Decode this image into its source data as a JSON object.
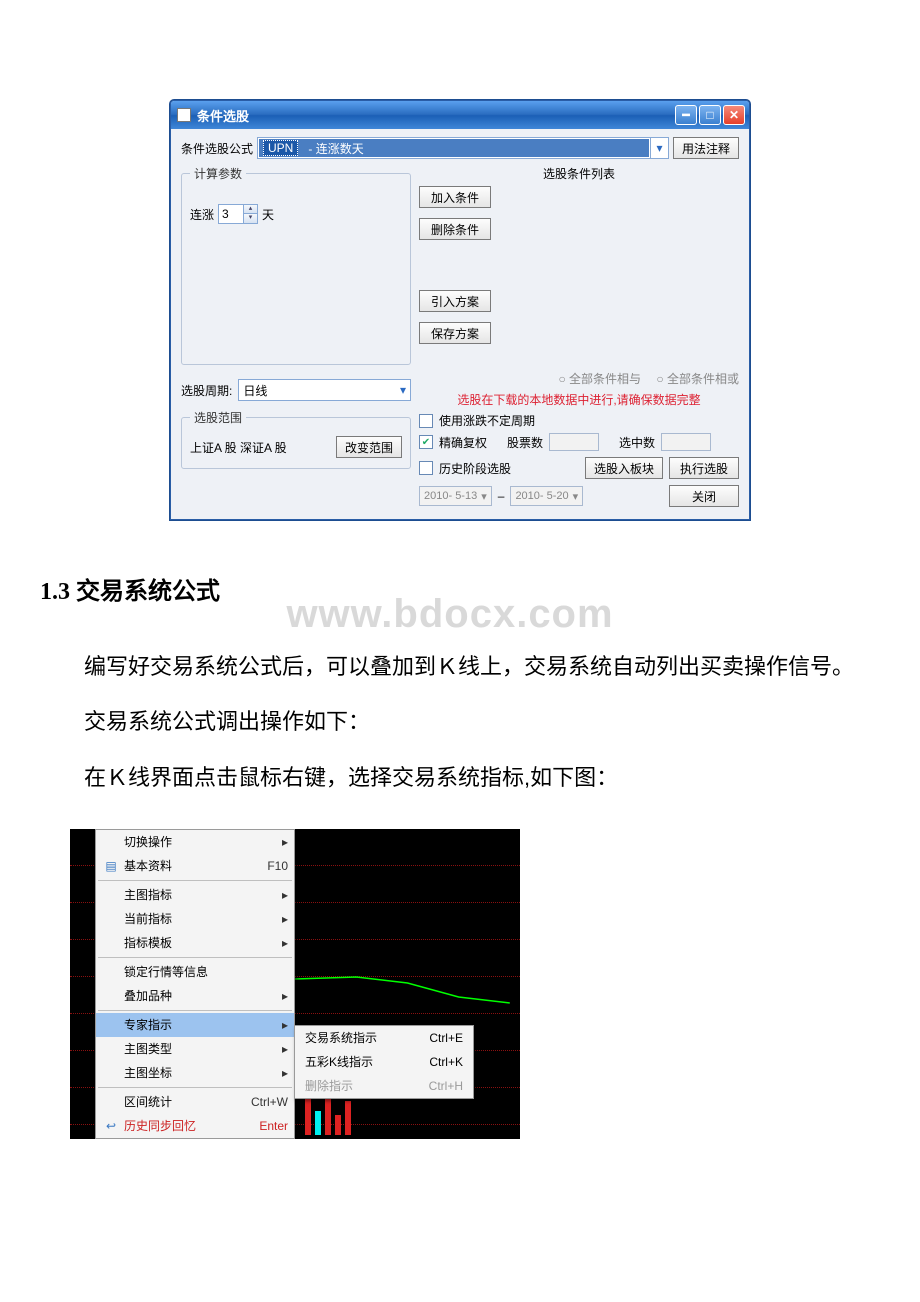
{
  "dialog": {
    "title": "条件选股",
    "formula_label": "条件选股公式",
    "formula_code": "UPN",
    "formula_name": "- 连涨数天",
    "usage_btn": "用法注释",
    "calc_group": "计算参数",
    "param_prefix": "连涨",
    "param_value": "3",
    "param_suffix": "天",
    "period_label": "选股周期:",
    "period_value": "日线",
    "range_group": "选股范围",
    "range_text": "上证A 股 深证A 股",
    "change_range_btn": "改变范围",
    "cond_list_title": "选股条件列表",
    "btn_add": "加入条件",
    "btn_del": "删除条件",
    "btn_import": "引入方案",
    "btn_save": "保存方案",
    "radio_and": "全部条件相与",
    "radio_or": "全部条件相或",
    "warning": "选股在下载的本地数据中进行,请确保数据完整",
    "chk_cycle": "使用涨跌不定周期",
    "chk_fuquan": "精确复权",
    "stock_count_lbl": "股票数",
    "selected_lbl": "选中数",
    "chk_history": "历史阶段选股",
    "date_from": "2010- 5-13",
    "date_to": "2010- 5-20",
    "btn_to_block": "选股入板块",
    "btn_exec": "执行选股",
    "btn_close": "关闭"
  },
  "doc": {
    "heading_prefix": "1.3",
    "heading": "交易系统公式",
    "watermark": "www.bdocx.com",
    "p1": "编写好交易系统公式后，可以叠加到Ｋ线上，交易系统自动列出买卖操作信号。",
    "p2": "交易系统公式调出操作如下：",
    "p3": "在Ｋ线界面点击鼠标右键，选择交易系统指标,如下图："
  },
  "menu": {
    "items": [
      {
        "label": "切换操作",
        "shortcut": "",
        "arrow": true,
        "icon": ""
      },
      {
        "label": "基本资料",
        "shortcut": "F10",
        "arrow": false,
        "icon": "list"
      },
      {
        "sep": true
      },
      {
        "label": "主图指标",
        "shortcut": "",
        "arrow": true
      },
      {
        "label": "当前指标",
        "shortcut": "",
        "arrow": true
      },
      {
        "label": "指标模板",
        "shortcut": "",
        "arrow": true
      },
      {
        "sep": true
      },
      {
        "label": "锁定行情等信息",
        "shortcut": "",
        "arrow": false
      },
      {
        "label": "叠加品种",
        "shortcut": "",
        "arrow": true
      },
      {
        "sep": true
      },
      {
        "label": "专家指示",
        "shortcut": "",
        "arrow": true,
        "hl": true
      },
      {
        "label": "主图类型",
        "shortcut": "",
        "arrow": true
      },
      {
        "label": "主图坐标",
        "shortcut": "",
        "arrow": true
      },
      {
        "sep": true
      },
      {
        "label": "区间统计",
        "shortcut": "Ctrl+W",
        "arrow": false
      },
      {
        "label": "历史同步回忆",
        "shortcut": "Enter",
        "arrow": false,
        "red": true,
        "icon": "back"
      }
    ],
    "sub": [
      {
        "label": "交易系统指示",
        "shortcut": "Ctrl+E"
      },
      {
        "label": "五彩K线指示",
        "shortcut": "Ctrl+K"
      },
      {
        "label": "删除指示",
        "shortcut": "Ctrl+H",
        "disabled": true
      }
    ]
  }
}
